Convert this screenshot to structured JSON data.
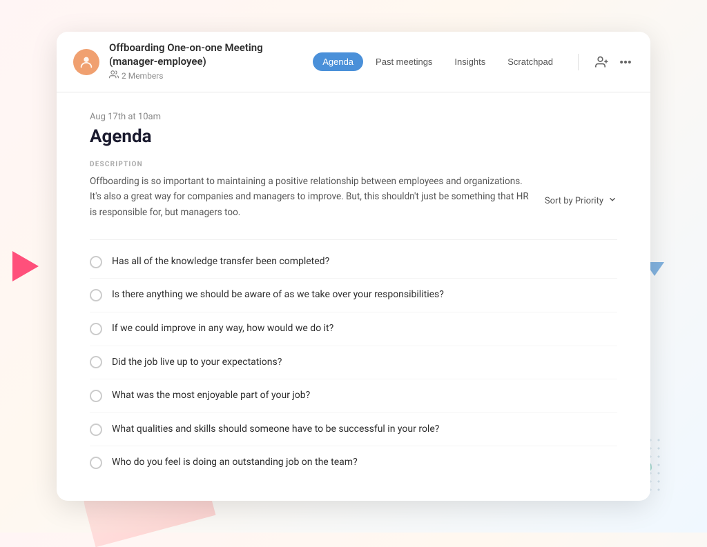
{
  "background": {
    "play_icon_alt": "play icon decoration",
    "triangle_alt": "triangle decoration",
    "blob_alt": "blob decoration",
    "dots_alt": "dots decoration"
  },
  "header": {
    "meeting_title": "Offboarding One-on-one Meeting (manager-employee)",
    "members_count": "2 Members",
    "tabs": [
      {
        "id": "agenda",
        "label": "Agenda",
        "active": true
      },
      {
        "id": "past-meetings",
        "label": "Past meetings",
        "active": false
      },
      {
        "id": "insights",
        "label": "Insights",
        "active": false
      },
      {
        "id": "scratchpad",
        "label": "Scratchpad",
        "active": false
      }
    ],
    "add_member_icon": "person-add-icon",
    "more_options_icon": "more-options-icon"
  },
  "body": {
    "date_label": "Aug 17th at 10am",
    "agenda_title": "Agenda",
    "sort_label": "Sort by Priority",
    "sort_icon": "chevron-down-icon",
    "section_label": "DESCRIPTION",
    "description": "Offboarding is so important to maintaining a positive relationship between employees and organizations. It's also a great way for companies and managers to improve. But, this shouldn't just be something that HR is responsible for, but managers too.",
    "questions": [
      {
        "id": 1,
        "text": "Has all of the knowledge transfer been completed?"
      },
      {
        "id": 2,
        "text": "Is there anything we should be aware of as we take over your responsibilities?"
      },
      {
        "id": 3,
        "text": "If we could improve in any way, how would we do it?"
      },
      {
        "id": 4,
        "text": "Did the job live up to your expectations?"
      },
      {
        "id": 5,
        "text": "What was the most enjoyable part of your job?"
      },
      {
        "id": 6,
        "text": "What qualities and skills should someone have to be successful in your role?"
      },
      {
        "id": 7,
        "text": "Who do you feel is doing an outstanding job on the team?"
      }
    ]
  },
  "colors": {
    "active_tab_bg": "#4a90d9",
    "play_icon": "#ff3366",
    "triangle": "#5b9bd5",
    "blob": "#6cc5b0"
  }
}
